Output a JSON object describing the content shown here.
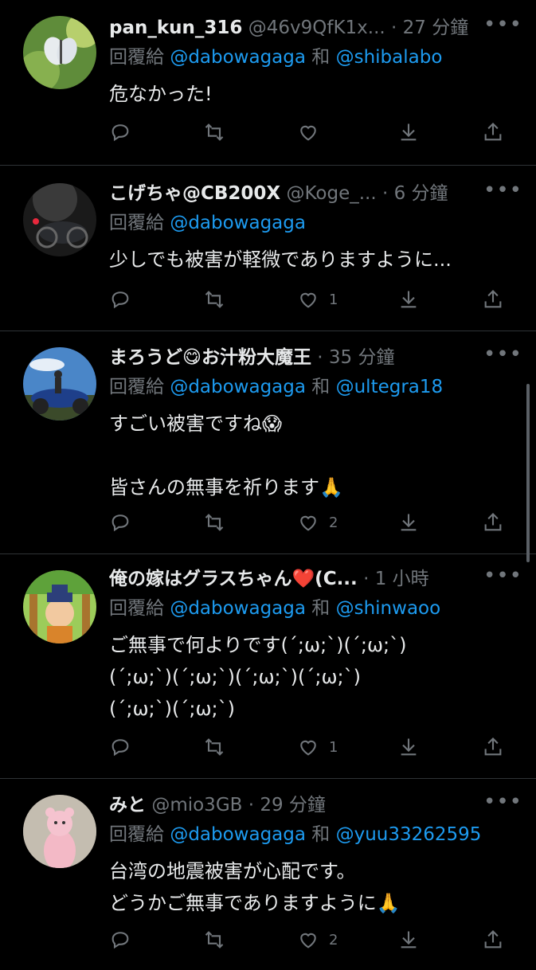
{
  "reply_prefix": "回覆給",
  "conjunction": "和",
  "tweets": [
    {
      "name": "pan_kun_316",
      "handle": "@46v9QfK1x...",
      "time": "27 分鐘",
      "reply_to": [
        "@dabowagaga",
        "@shibalabo"
      ],
      "lines": [
        "危なかった!"
      ],
      "likes": ""
    },
    {
      "name": "こげちゃ@CB200X",
      "handle": "@Koge_...",
      "time": "6 分鐘",
      "reply_to": [
        "@dabowagaga"
      ],
      "lines": [
        "少しでも被害が軽微でありますように..."
      ],
      "likes": "1"
    },
    {
      "name": "まろうど😋お汁粉大魔王",
      "handle": "",
      "time": "35 分鐘",
      "reply_to": [
        "@dabowagaga",
        "@ultegra18"
      ],
      "lines": [
        "すごい被害ですね😱",
        "",
        "皆さんの無事を祈ります🙏"
      ],
      "likes": "2"
    },
    {
      "name": "俺の嫁はグラスちゃん❤️(C...",
      "handle": "",
      "time": "1 小時",
      "reply_to": [
        "@dabowagaga",
        "@shinwaoo"
      ],
      "lines": [
        "ご無事で何よりです(´;ω;`)(´;ω;`)",
        "(´;ω;`)(´;ω;`)(´;ω;`)(´;ω;`)",
        "(´;ω;`)(´;ω;`)"
      ],
      "likes": "1"
    },
    {
      "name": "みと",
      "handle": "@mio3GB",
      "time": "29 分鐘",
      "reply_to": [
        "@dabowagaga",
        "@yuu33262595"
      ],
      "lines": [
        "台湾の地震被害が心配です。",
        "どうかご無事でありますように🙏"
      ],
      "likes": "2"
    }
  ],
  "icons": {
    "more": "more-horizontal-icon",
    "reply": "reply-bubble-icon",
    "retweet": "retweet-icon",
    "like": "heart-icon",
    "download": "download-arrow-icon",
    "share": "share-upload-icon"
  },
  "colors": {
    "background": "#000000",
    "text": "#e7e9ea",
    "secondary": "#71767b",
    "mention": "#1d9bf0",
    "divider": "#2f3336"
  }
}
